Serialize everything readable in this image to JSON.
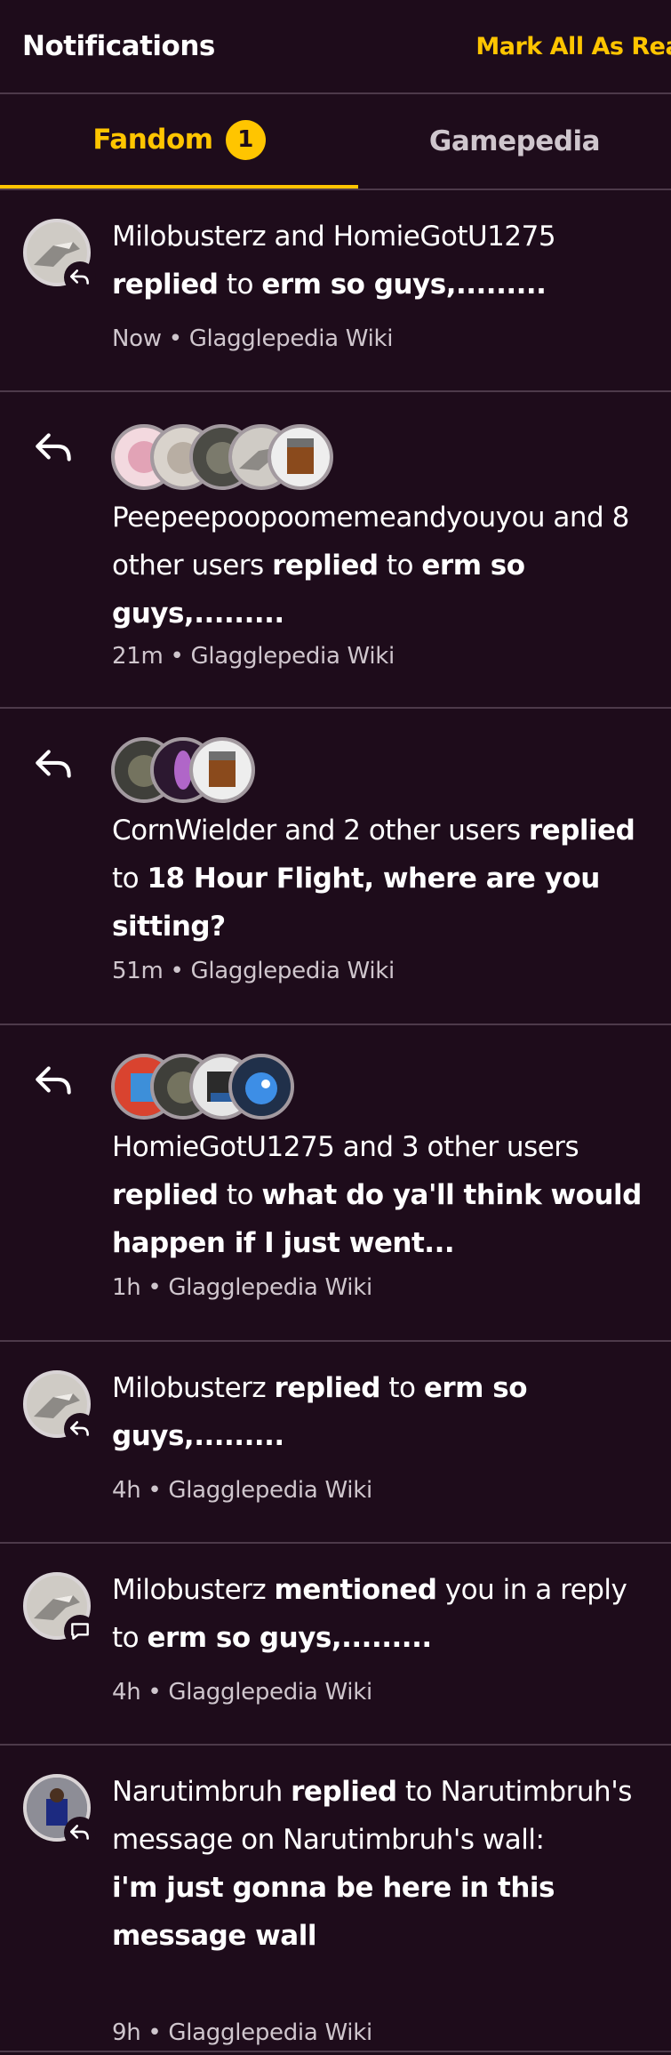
{
  "header": {
    "title": "Notifications",
    "mark_all": "Mark All As Read"
  },
  "tabs": [
    {
      "label": "Fandom",
      "count": "1"
    },
    {
      "label": "Gamepedia"
    }
  ],
  "notifications": [
    {
      "p1": "Milobusterz and HomieGotU1275",
      "b1": " replied",
      "p2": " to ",
      "b2": "erm so guys,.........",
      "time": "Now",
      "wiki": "Glagglepedia Wiki",
      "icon": "reply-icon"
    },
    {
      "p1": "Peepeepoopoomemeandyouyou and 8 other users ",
      "b1": "replied",
      "p2": " to ",
      "b2": "erm so guys,.........",
      "time": "21m",
      "wiki": "Glagglepedia Wiki",
      "icon": "reply-icon"
    },
    {
      "p1": "CornWielder and 2 other users ",
      "b1": "replied",
      "p2": " to ",
      "b2": "18 Hour Flight, where are you sitting?",
      "time": "51m",
      "wiki": "Glagglepedia Wiki",
      "icon": "reply-icon"
    },
    {
      "p1": "HomieGotU1275 and 3 other users ",
      "b1": "replied",
      "p2": " to ",
      "b2": "what do ya'll think would happen if I just went...",
      "time": "1h",
      "wiki": "Glagglepedia Wiki",
      "icon": "reply-icon"
    },
    {
      "p1": "Milobusterz ",
      "b1": "replied",
      "p2": " to ",
      "b2": "erm so guys,.........",
      "time": "4h",
      "wiki": "Glagglepedia Wiki",
      "icon": "reply-icon"
    },
    {
      "p1": "Milobusterz ",
      "b1": "mentioned",
      "p2": " you in a reply to ",
      "b2": "erm so guys,.........",
      "time": "4h",
      "wiki": "Glagglepedia Wiki",
      "icon": "comment-icon"
    },
    {
      "p1": "Narutimbruh ",
      "b1": "replied",
      "p2": " to Narutimbruh's message on Narutimbruh's wall:",
      "b2": "i'm just gonna be here in this message wall",
      "time": "9h",
      "wiki": "Glagglepedia Wiki",
      "icon": "reply-icon"
    }
  ],
  "colors": {
    "accent": "#ffc500",
    "background": "#1e0c1b",
    "divider": "#4d3a4a"
  }
}
